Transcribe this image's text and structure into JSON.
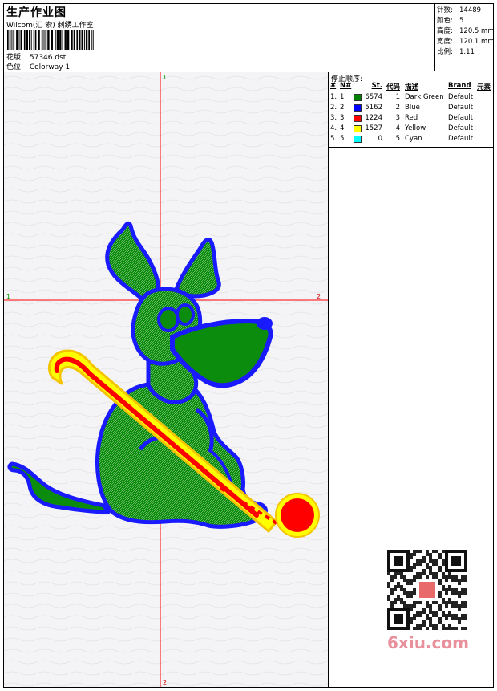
{
  "header": {
    "title": "生产作业图",
    "subtitle": "Wilcom(汇 索) 刺绣工作室",
    "design_label": "花版:",
    "design_value": "57346.dst",
    "colorway_label": "色位:",
    "colorway_value": "Colorway 1"
  },
  "stats": [
    {
      "label": "针数:",
      "value": "14489"
    },
    {
      "label": "颜色:",
      "value": "5"
    },
    {
      "label": "高度:",
      "value": "120.5 mm"
    },
    {
      "label": "宽度:",
      "value": "120.1 mm"
    },
    {
      "label": "比例:",
      "value": "1.11"
    }
  ],
  "markers": {
    "top": "1",
    "bottom": "2",
    "left": "1",
    "right": "2"
  },
  "stop_sequence": {
    "title": "停止顺序:",
    "headers": {
      "no": "#",
      "ord": "N#",
      "st": "St.",
      "code": "代码",
      "desc": "描述",
      "brand": "Brand",
      "elem": "元素"
    },
    "rows": [
      {
        "no": "1.",
        "ord": "1",
        "color": "#008000",
        "stitches": "6574",
        "code": "1",
        "desc": "Dark Green",
        "brand": "Default"
      },
      {
        "no": "2.",
        "ord": "2",
        "color": "#0000ff",
        "stitches": "5162",
        "code": "2",
        "desc": "Blue",
        "brand": "Default"
      },
      {
        "no": "3.",
        "ord": "3",
        "color": "#ff0000",
        "stitches": "1224",
        "code": "3",
        "desc": "Red",
        "brand": "Default"
      },
      {
        "no": "4.",
        "ord": "4",
        "color": "#ffff00",
        "stitches": "1527",
        "code": "4",
        "desc": "Yellow",
        "brand": "Default"
      },
      {
        "no": "5.",
        "ord": "5",
        "color": "#00ffff",
        "stitches": "0",
        "code": "5",
        "desc": "Cyan",
        "brand": "Default"
      }
    ]
  },
  "watermark": {
    "brand": "6xiu.com",
    "brand_color": "#e8909b"
  },
  "colors": {
    "dark_green": "#0a8a0a",
    "blue": "#1a1aff",
    "red": "#ff0000",
    "yellow": "#ffff00",
    "crosshair": "#ff0000",
    "marker_green": "#009900",
    "marker_red": "#cc0000"
  }
}
